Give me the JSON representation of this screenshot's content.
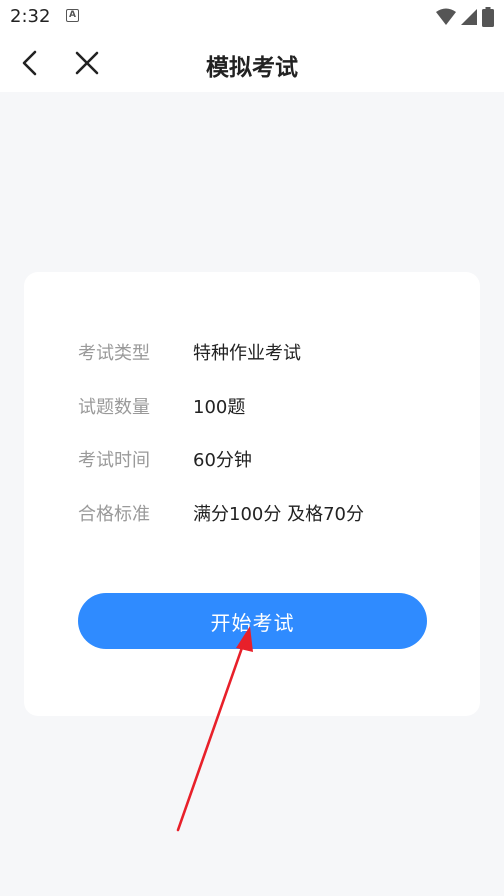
{
  "status_bar": {
    "time": "2:32",
    "notification_icon": "a-icon",
    "icons": [
      "wifi-icon",
      "signal-icon",
      "battery-icon"
    ]
  },
  "nav": {
    "title": "模拟考试",
    "back_icon": "chevron-left-icon",
    "close_icon": "close-icon"
  },
  "exam_info": {
    "rows": [
      {
        "label": "考试类型",
        "value": "特种作业考试"
      },
      {
        "label": "试题数量",
        "value": "100题"
      },
      {
        "label": "考试时间",
        "value": "60分钟"
      },
      {
        "label": "合格标准",
        "value": "满分100分 及格70分"
      }
    ]
  },
  "start_button": {
    "label": "开始考试"
  },
  "colors": {
    "accent": "#2f8bff",
    "annotation_arrow": "#e8202a",
    "background": "#f6f7f9"
  }
}
